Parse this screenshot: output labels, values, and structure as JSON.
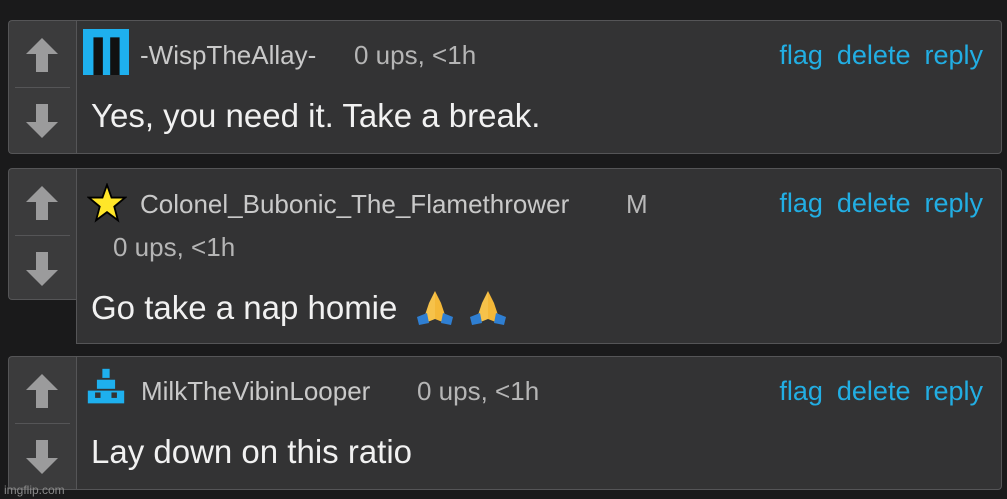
{
  "actions": {
    "flag": "flag",
    "delete": "delete",
    "reply": "reply"
  },
  "comments": [
    {
      "username": "-WispTheAllay-",
      "badge": "",
      "meta": "0 ups, <1h",
      "text": "Yes, you need it. Take a break.",
      "avatar_icon": "pause-icon",
      "avatar_color": "#1eb0ee"
    },
    {
      "username": "Colonel_Bubonic_The_Flamethrower",
      "badge": "M",
      "meta": "0 ups, <1h",
      "text": "Go take a nap homie",
      "emojis": [
        "folded-hands-icon",
        "folded-hands-icon"
      ],
      "avatar_icon": "star-icon",
      "avatar_color": "#ffe629"
    },
    {
      "username": "MilkTheVibinLooper",
      "badge": "",
      "meta": "0 ups, <1h",
      "text": "Lay down on this ratio",
      "avatar_icon": "pixel-ship-icon",
      "avatar_color": "#1eb0ee"
    }
  ],
  "watermark": "imgflip.com",
  "colors": {
    "background": "#1a1a1b",
    "panel": "#333334",
    "vote_panel": "#3b3b3c",
    "link": "#22aee3",
    "text": "#f1f1f1"
  }
}
